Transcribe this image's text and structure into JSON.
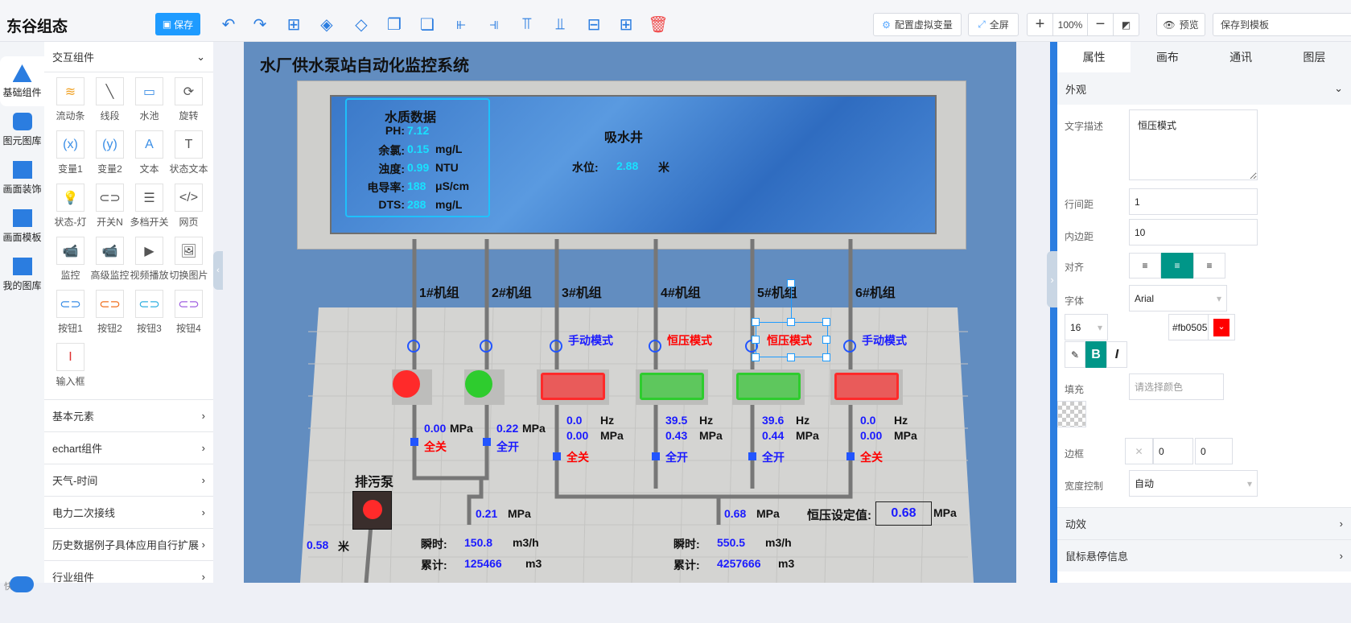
{
  "app": {
    "title": "东谷组态",
    "save": "保存"
  },
  "toolbar": {
    "icons": [
      "undo-icon",
      "redo-icon",
      "new-page-icon",
      "layer-up-icon",
      "layer-down-icon",
      "bring-front-icon",
      "send-back-icon",
      "align-left-icon",
      "align-right-icon",
      "align-top-icon",
      "align-bottom-icon",
      "align-vcenter-icon",
      "align-hcenter-icon",
      "delete-icon"
    ],
    "config_vars": "配置虚拟变量",
    "fullscreen": "全屏",
    "zoom": "100%",
    "preview": "预览",
    "save_template": "保存到模板"
  },
  "sidebar": {
    "items": [
      "基础组件",
      "图元图库",
      "画面装饰",
      "画面模板",
      "我的图库"
    ],
    "shortcut": "快捷键"
  },
  "components": {
    "section": "交互组件",
    "items": [
      "流动条",
      "线段",
      "水池",
      "旋转",
      "变量1",
      "变量2",
      "文本",
      "状态文本",
      "状态-灯",
      "开关N",
      "多档开关",
      "网页",
      "监控",
      "高级监控",
      "视频播放",
      "切换图片",
      "按钮1",
      "按钮2",
      "按钮3",
      "按钮4",
      "输入框"
    ],
    "categories": [
      "基本元素",
      "echart组件",
      "天气-时间",
      "电力二次接线",
      "历史数据例子具体应用自行扩展",
      "行业组件"
    ]
  },
  "canvas": {
    "title": "水厂供水泵站自动化监控系统",
    "quality": {
      "title": "水质数据",
      "rows": [
        {
          "k": "PH:",
          "v": "7.12",
          "u": ""
        },
        {
          "k": "余氯:",
          "v": "0.15",
          "u": "mg/L"
        },
        {
          "k": "浊度:",
          "v": "0.99",
          "u": "NTU"
        },
        {
          "k": "电导率:",
          "v": "188",
          "u": "μS/cm"
        },
        {
          "k": "DTS:",
          "v": "288",
          "u": "mg/L"
        }
      ]
    },
    "well": {
      "title": "吸水井",
      "level_label": "水位:",
      "level": "2.88",
      "level_unit": "米"
    },
    "units": [
      {
        "name": "1#机组",
        "mode": "",
        "freq": "",
        "pressure": "0.00",
        "valve": "全关",
        "state": "off"
      },
      {
        "name": "2#机组",
        "mode": "",
        "freq": "",
        "pressure": "0.22",
        "valve": "全开",
        "state": "on"
      },
      {
        "name": "3#机组",
        "mode": "手动模式",
        "freq": "0.0",
        "pressure": "0.00",
        "valve": "全关",
        "state": "off"
      },
      {
        "name": "4#机组",
        "mode": "恒压模式",
        "freq": "39.5",
        "pressure": "0.43",
        "valve": "全开",
        "state": "on"
      },
      {
        "name": "5#机组",
        "mode": "恒压模式",
        "freq": "39.6",
        "pressure": "0.44",
        "valve": "全开",
        "state": "on"
      },
      {
        "name": "6#机组",
        "mode": "手动模式",
        "freq": "0.0",
        "pressure": "0.00",
        "valve": "全关",
        "state": "off"
      }
    ],
    "units_label": {
      "hz": "Hz",
      "mpa": "MPa"
    },
    "sewage": {
      "title": "排污泵",
      "level": "0.58",
      "unit": "米"
    },
    "left_main": {
      "pressure": "0.21",
      "unit": "MPa",
      "inst_label": "瞬时:",
      "inst": "150.8",
      "inst_unit": "m3/h",
      "total_label": "累计:",
      "total": "125466",
      "total_unit": "m3"
    },
    "right_main": {
      "pressure": "0.68",
      "unit": "MPa",
      "inst_label": "瞬时:",
      "inst": "550.5",
      "inst_unit": "m3/h",
      "total_label": "累计:",
      "total": "4257666",
      "total_unit": "m3"
    },
    "setpoint": {
      "label": "恒压设定值:",
      "value": "0.68",
      "unit": "MPa"
    }
  },
  "props": {
    "tabs": [
      "属性",
      "画布",
      "通讯",
      "图层"
    ],
    "section": "外观",
    "text_label": "文字描述",
    "text": "恒压模式",
    "line_label": "行间距",
    "line": "1",
    "pad_label": "内边距",
    "pad": "10",
    "align_label": "对齐",
    "font_label": "字体",
    "font": "Arial",
    "size": "16",
    "color": "#fb0505",
    "fill_label": "填充",
    "fill_placeholder": "请选择颜色",
    "border_label": "边框",
    "border_w": "0",
    "border_r": "0",
    "width_label": "宽度控制",
    "width": "自动",
    "anim": "动效",
    "hover": "鼠标悬停信息"
  },
  "colors": {
    "accent": "#1e9bff",
    "on": "#2ecc2e",
    "off": "#ff2a2a",
    "selected_text": "#fb0505",
    "active_toggle": "#009688"
  }
}
